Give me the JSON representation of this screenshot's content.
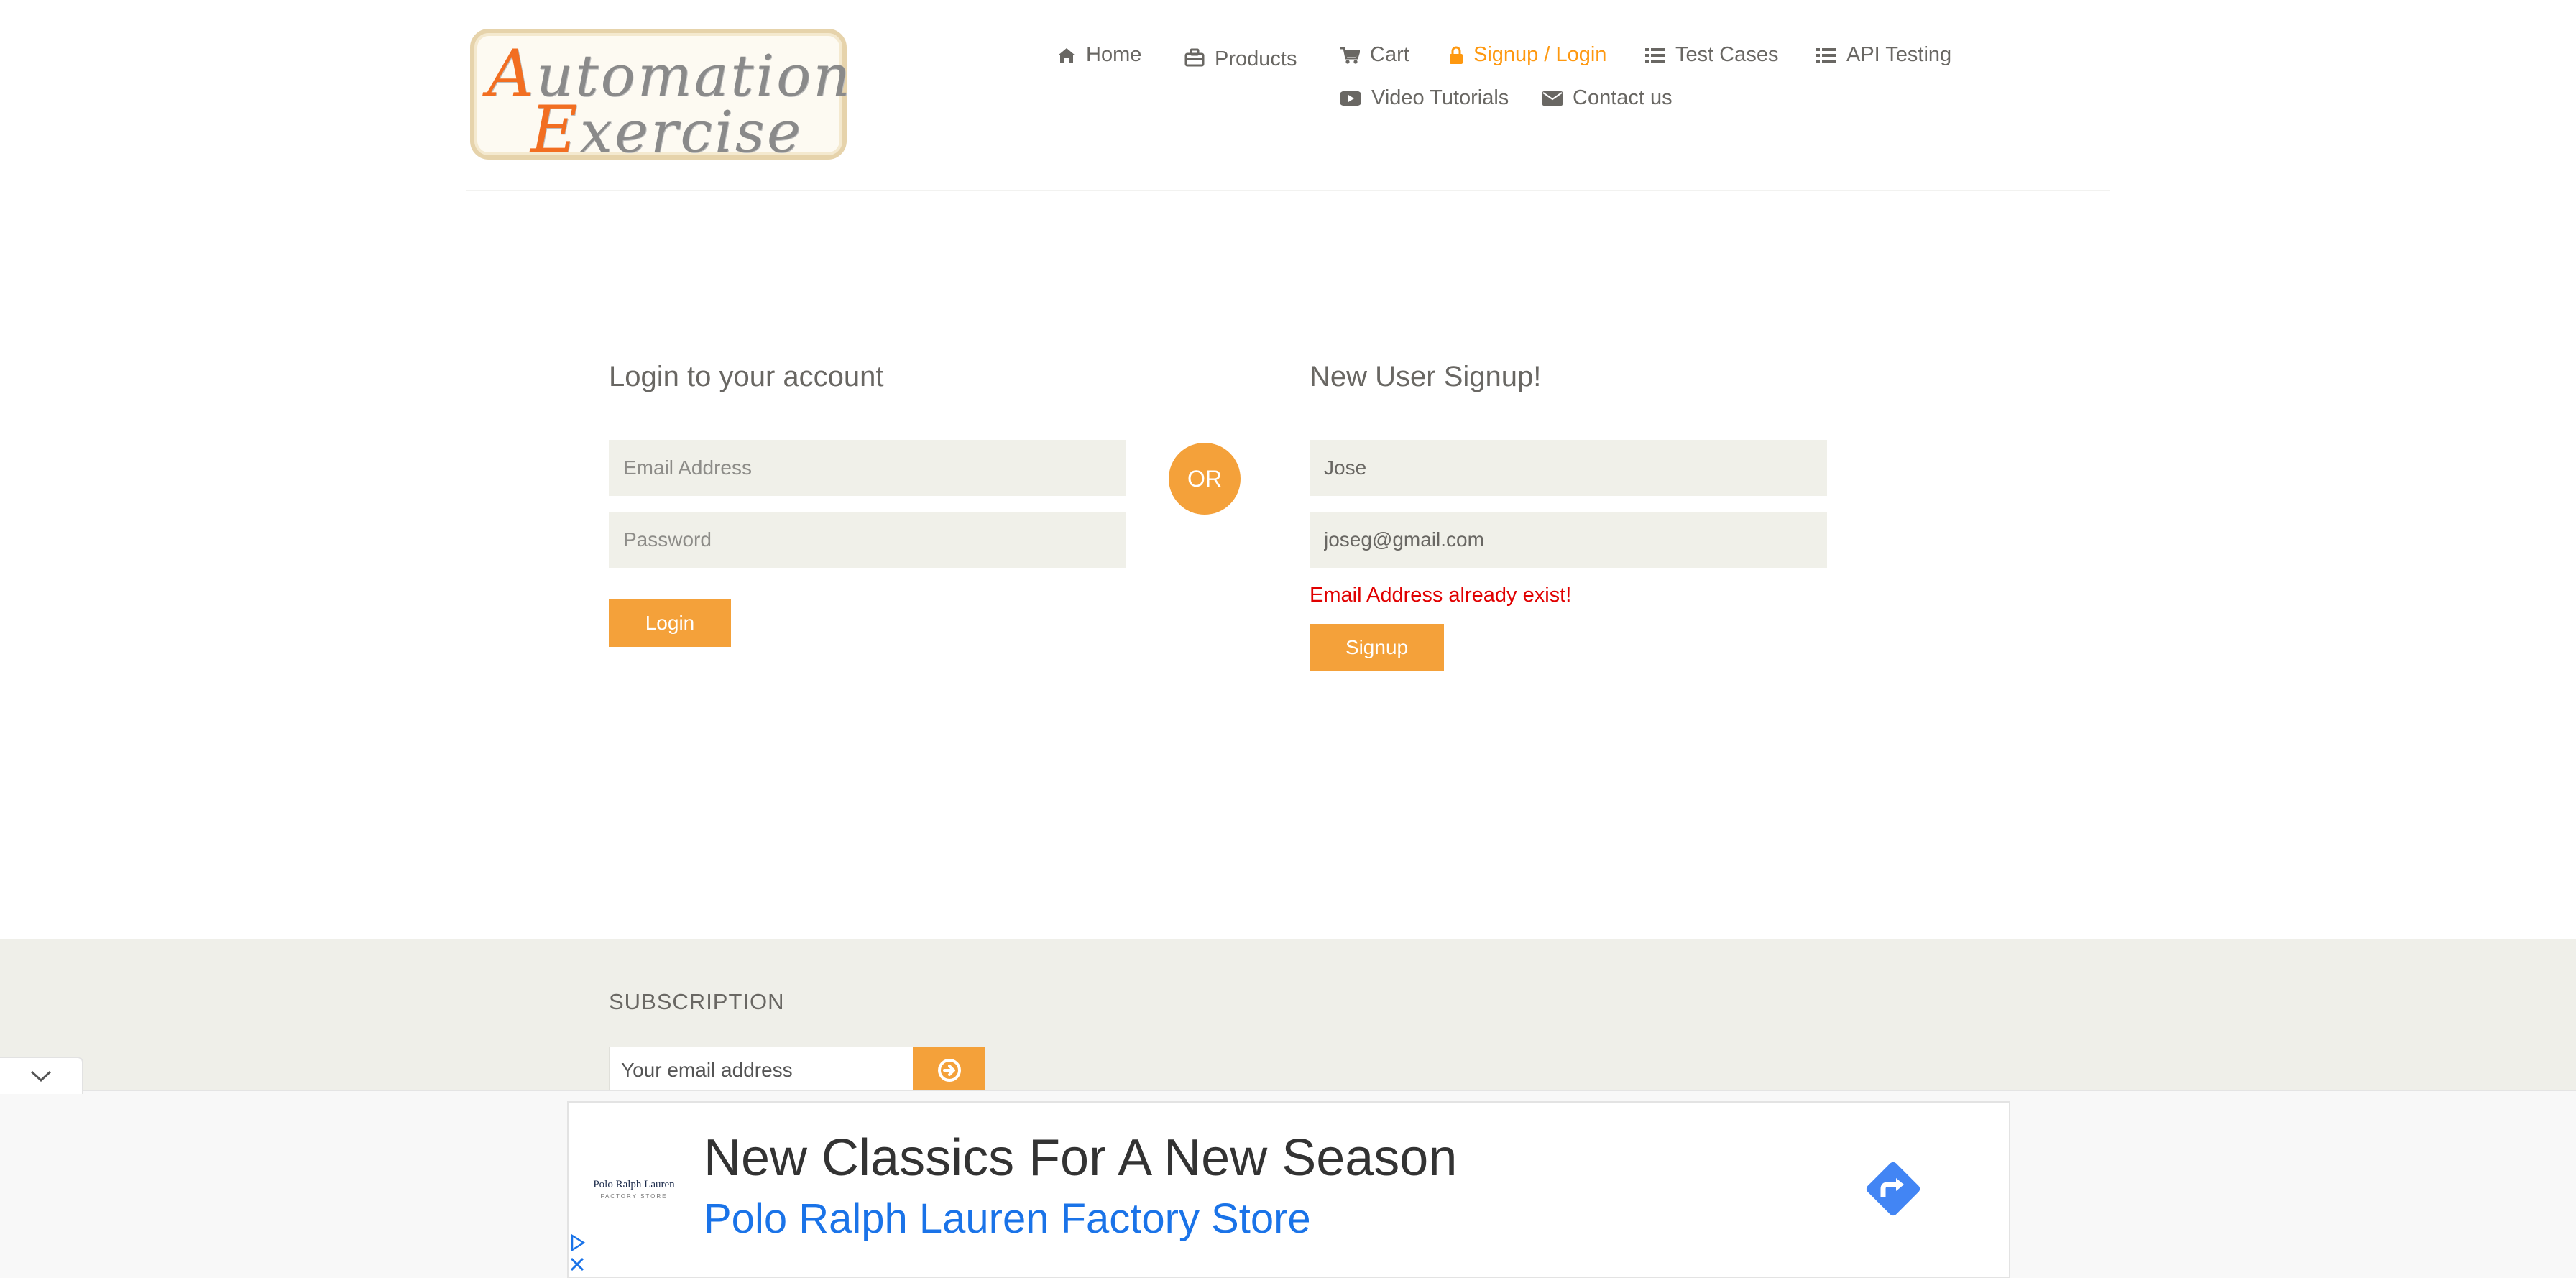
{
  "logo": {
    "line1_first": "A",
    "line1_rest": "utomation",
    "line2_first": "E",
    "line2_rest": "xercise"
  },
  "nav": {
    "home": "Home",
    "products": "Products",
    "cart": "Cart",
    "signup_login": "Signup / Login",
    "test_cases": "Test Cases",
    "api_testing": "API Testing",
    "video_tutorials": "Video Tutorials",
    "contact_us": "Contact us",
    "active_item": "Signup / Login"
  },
  "login": {
    "title": "Login to your account",
    "email_placeholder": "Email Address",
    "password_placeholder": "Password",
    "button": "Login"
  },
  "or_label": "OR",
  "signup": {
    "title": "New User Signup!",
    "name_value": "Jose",
    "email_value": "joseg@gmail.com",
    "error": "Email Address already exist!",
    "button": "Signup"
  },
  "subscription": {
    "title": "SUBSCRIPTION",
    "email_placeholder": "Your email address"
  },
  "ad": {
    "brand": "Polo Ralph Lauren",
    "brand_sub": "FACTORY STORE",
    "headline": "New Classics For A New Season",
    "advertiser": "Polo Ralph Lauren Factory Store"
  },
  "colors": {
    "accent": "#FE980F",
    "text": "#696763",
    "field_bg": "#F0F0E9",
    "error": "#E00000",
    "ad_link": "#1A73E8",
    "ad_arrow": "#4285F4"
  }
}
